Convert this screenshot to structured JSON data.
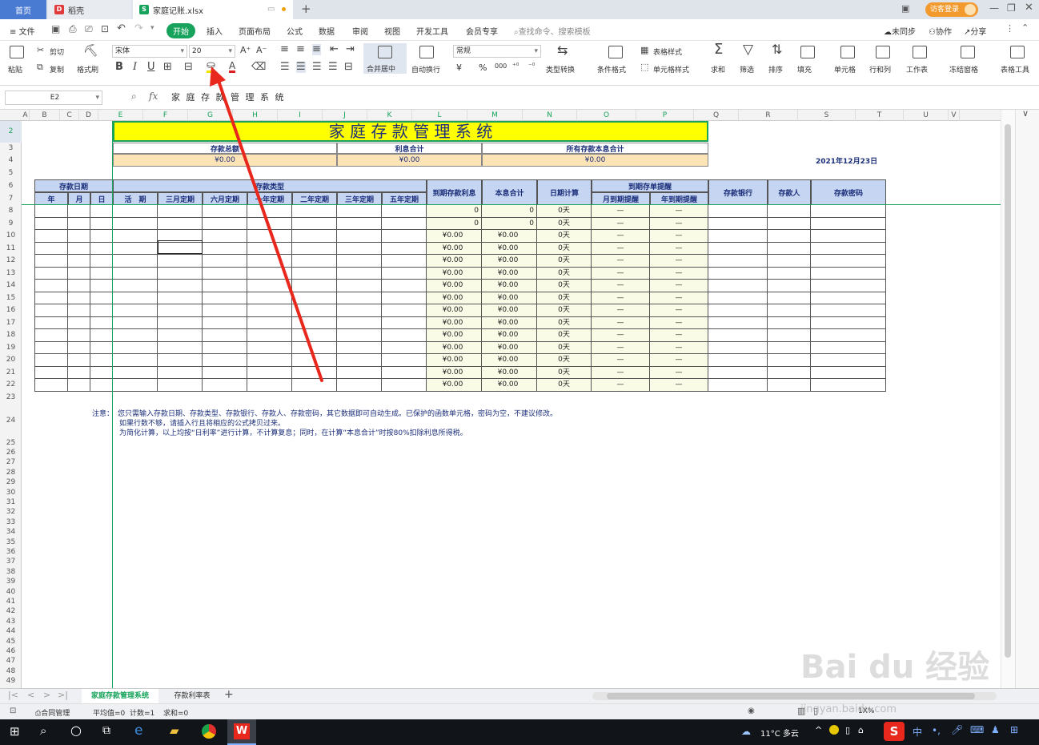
{
  "window": {
    "tab_home": "首页",
    "tab_docer": "稻壳",
    "tab_file": "家庭记账.xlsx",
    "login_button": "访客登录"
  },
  "menu": {
    "file": "文件",
    "start": "开始",
    "items": [
      "插入",
      "页面布局",
      "公式",
      "数据",
      "审阅",
      "视图",
      "开发工具",
      "会员专享"
    ],
    "search": "查找命令、搜索模板",
    "sync": "未同步",
    "collab": "协作",
    "share": "分享"
  },
  "ribbon": {
    "paste": "粘贴",
    "cut": "剪切",
    "copy": "复制",
    "format_painter": "格式刷",
    "font_name": "宋体",
    "font_size": "20",
    "merge_center": "合并居中",
    "auto_wrap": "自动换行",
    "number_format": "常规",
    "type_convert": "类型转换",
    "cond_format": "条件格式",
    "table_style": "表格样式",
    "cell_style": "单元格样式",
    "sum": "求和",
    "filter": "筛选",
    "sort": "排序",
    "fill": "填充",
    "cell": "单元格",
    "row_col": "行和列",
    "worksheet": "工作表",
    "freeze": "冻结窗格",
    "table_tools": "表格工具",
    "currency_sym": "¥",
    "percent_sym": "%",
    "thousands_sym": "000"
  },
  "formula_bar": {
    "name_box": "E2",
    "fx": "fx",
    "content": "家 庭 存 款 管 理 系 统"
  },
  "columns": [
    "A",
    "B",
    "C",
    "D",
    "E",
    "F",
    "G",
    "H",
    "I",
    "J",
    "K",
    "L",
    "M",
    "N",
    "O",
    "P",
    "Q",
    "R",
    "S",
    "T",
    "U",
    "V"
  ],
  "rows": [
    "2",
    "3",
    "4",
    "5",
    "6",
    "7",
    "8",
    "9",
    "10",
    "11",
    "12",
    "13",
    "14",
    "15",
    "16",
    "17",
    "18",
    "19",
    "20",
    "21",
    "22",
    "23",
    "24",
    "25",
    "26",
    "27",
    "28",
    "29",
    "30",
    "31",
    "32",
    "33",
    "34",
    "35",
    "36",
    "37",
    "38",
    "39",
    "40",
    "41",
    "42",
    "43",
    "44",
    "45",
    "46",
    "47",
    "48",
    "49"
  ],
  "sheet": {
    "title": "家  庭  存  款  管  理  系  统",
    "summary_headers": [
      "存款总额",
      "利息合计",
      "所有存款本息合计"
    ],
    "summary_values": [
      "¥0.00",
      "¥0.00",
      "¥0.00"
    ],
    "date": "2021年12月23日",
    "group_headers": {
      "deposit_date": "存款日期",
      "deposit_type": "存款类型",
      "reminder": "到期存单提醒"
    },
    "date_cols": [
      "年",
      "月",
      "日"
    ],
    "type_cols": [
      "活　期",
      "三月定期",
      "六月定期",
      "一年定期",
      "二年定期",
      "三年定期",
      "五年定期"
    ],
    "calc_cols": [
      "到期存款利息",
      "本息合计",
      "日期计算"
    ],
    "reminder_cols": [
      "月到期提醒",
      "年到期提醒"
    ],
    "info_cols": [
      "存款银行",
      "存款人",
      "存款密码"
    ],
    "rows_data": [
      {
        "interest": "0",
        "total": "0",
        "days": "0天",
        "month_remind": "—",
        "year_remind": "—"
      },
      {
        "interest": "0",
        "total": "0",
        "days": "0天",
        "month_remind": "—",
        "year_remind": "—"
      },
      {
        "interest": "¥0.00",
        "total": "¥0.00",
        "days": "0天",
        "month_remind": "—",
        "year_remind": "—"
      },
      {
        "interest": "¥0.00",
        "total": "¥0.00",
        "days": "0天",
        "month_remind": "—",
        "year_remind": "—"
      },
      {
        "interest": "¥0.00",
        "total": "¥0.00",
        "days": "0天",
        "month_remind": "—",
        "year_remind": "—"
      },
      {
        "interest": "¥0.00",
        "total": "¥0.00",
        "days": "0天",
        "month_remind": "—",
        "year_remind": "—"
      },
      {
        "interest": "¥0.00",
        "total": "¥0.00",
        "days": "0天",
        "month_remind": "—",
        "year_remind": "—"
      },
      {
        "interest": "¥0.00",
        "total": "¥0.00",
        "days": "0天",
        "month_remind": "—",
        "year_remind": "—"
      },
      {
        "interest": "¥0.00",
        "total": "¥0.00",
        "days": "0天",
        "month_remind": "—",
        "year_remind": "—"
      },
      {
        "interest": "¥0.00",
        "total": "¥0.00",
        "days": "0天",
        "month_remind": "—",
        "year_remind": "—"
      },
      {
        "interest": "¥0.00",
        "total": "¥0.00",
        "days": "0天",
        "month_remind": "—",
        "year_remind": "—"
      },
      {
        "interest": "¥0.00",
        "total": "¥0.00",
        "days": "0天",
        "month_remind": "—",
        "year_remind": "—"
      },
      {
        "interest": "¥0.00",
        "total": "¥0.00",
        "days": "0天",
        "month_remind": "—",
        "year_remind": "—"
      },
      {
        "interest": "¥0.00",
        "total": "¥0.00",
        "days": "0天",
        "month_remind": "—",
        "year_remind": "—"
      },
      {
        "interest": "¥0.00",
        "total": "¥0.00",
        "days": "0天",
        "month_remind": "—",
        "year_remind": "—"
      }
    ],
    "note_label": "注意：",
    "note_lines": [
      "您只需输入存款日期、存款类型、存款银行、存款人、存款密码，其它数据即可自动生成。已保护的函数单元格，密码为空，不建议修改。",
      "如果行数不够，请插入行且将相应的公式拷贝过来。",
      "为简化计算，以上均按“日利率”进行计算，不计算复息；同时，在计算“本息合计”时按80%扣除利息所得税。"
    ]
  },
  "sheet_tabs": [
    "家庭存款管理系统",
    "存款利率表"
  ],
  "status": {
    "contract": "合同管理",
    "avg": "平均值=0",
    "count": "计数=1",
    "sum": "求和=0",
    "zoom": "1X%"
  },
  "taskbar": {
    "weather": "11°C 多云",
    "ime": "中"
  },
  "watermark": "Bai du 经验",
  "watermark_url": "jingyan.baidu.com",
  "colors": {
    "title_bg": "#ffff00",
    "header_bg": "#c6d6f2",
    "summary_bg": "#fce4b6",
    "calc_bg": "#fafbe6",
    "accent": "#17a35b",
    "arrow": "#e8271d"
  }
}
